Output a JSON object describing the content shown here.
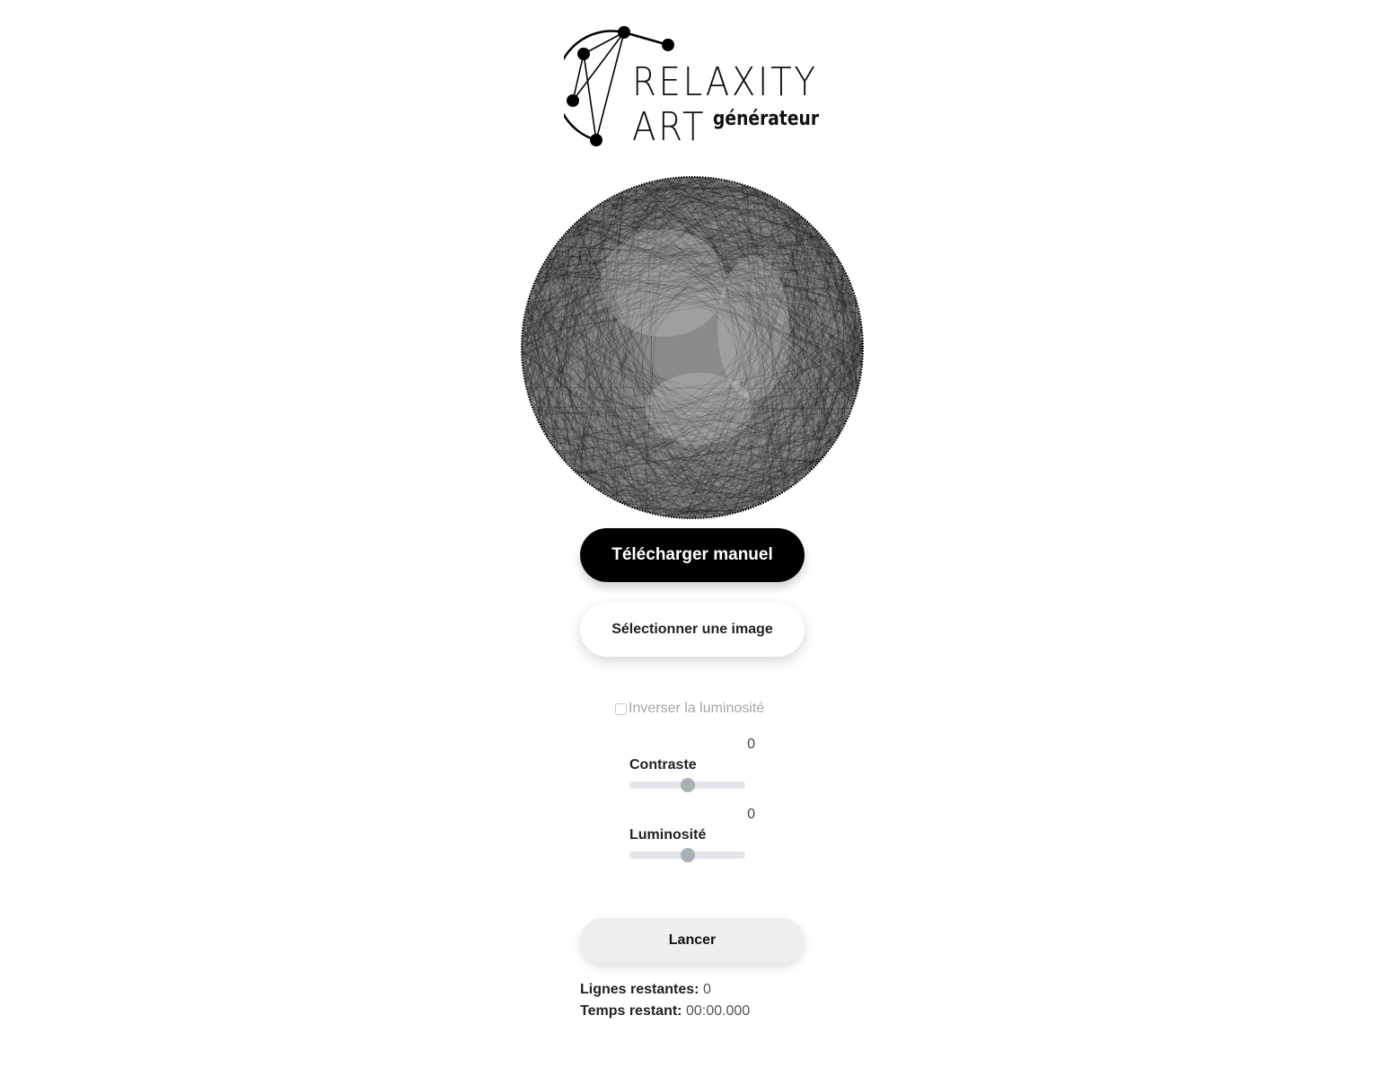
{
  "logo": {
    "line1": "RELAXITY",
    "line2": "ART",
    "subtitle": "générateur"
  },
  "buttons": {
    "download_manual": "Télécharger manuel",
    "select_image": "Sélectionner une image",
    "run": "Lancer"
  },
  "invert": {
    "label": "Inverser la luminosité",
    "checked": false
  },
  "sliders": {
    "contrast": {
      "label": "Contraste",
      "value": "0",
      "level": 0.5
    },
    "brightness": {
      "label": "Luminosité",
      "value": "0",
      "level": 0.5
    }
  },
  "stats": {
    "lines_label": "Lignes restantes:",
    "lines_value": "0",
    "time_label": "Temps restant:",
    "time_value": "00:00.000"
  }
}
